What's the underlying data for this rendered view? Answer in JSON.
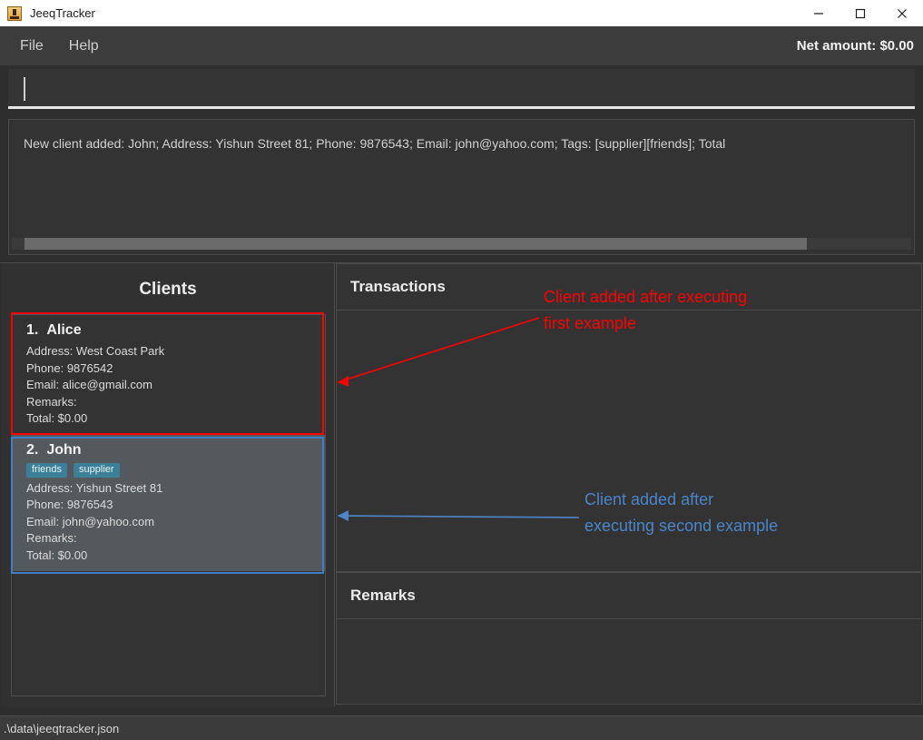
{
  "window": {
    "title": "JeeqTracker",
    "icon": "app-icon",
    "controls": [
      {
        "name": "minimize",
        "glyph": "minimize-icon"
      },
      {
        "name": "maximize",
        "glyph": "maximize-icon"
      },
      {
        "name": "close",
        "glyph": "close-icon"
      }
    ]
  },
  "menubar": {
    "items": [
      {
        "label": "File"
      },
      {
        "label": "Help"
      }
    ],
    "net_amount_label": "Net amount: $0.00"
  },
  "command_input": {
    "value": "",
    "placeholder": ""
  },
  "result_display": {
    "text": "New client added: John; Address: Yishun Street 81; Phone: 9876543; Email: john@yahoo.com; Tags: [supplier][friends]; Total"
  },
  "clients_panel": {
    "title": "Clients",
    "cards": [
      {
        "index": "1.",
        "name": "Alice",
        "tags": [],
        "address": "Address: West Coast Park",
        "phone": "Phone: 9876542",
        "email": "Email: alice@gmail.com",
        "remarks": "Remarks:",
        "total": "Total: $0.00",
        "selected": false
      },
      {
        "index": "2.",
        "name": "John",
        "tags": [
          "friends",
          "supplier"
        ],
        "address": "Address: Yishun Street 81",
        "phone": "Phone: 9876543",
        "email": "Email: john@yahoo.com",
        "remarks": "Remarks:",
        "total": "Total: $0.00",
        "selected": true
      }
    ]
  },
  "transactions_panel": {
    "title": "Transactions",
    "items": []
  },
  "remarks_panel": {
    "title": "Remarks",
    "items": []
  },
  "statusbar": {
    "file_path": ".\\data\\jeeqtracker.json"
  },
  "annotations": [
    {
      "id": "first-example",
      "text": "Client added after executing\nfirst example",
      "color": "#ff0000"
    },
    {
      "id": "second-example",
      "text": "Client added after\nexecuting second example",
      "color": "#4a86c8"
    }
  ],
  "colors": {
    "window_bg": "#2e2e2e",
    "panel_bg": "#333333",
    "menubar_bg": "#3c3c3c",
    "titlebar_bg": "#ffffff",
    "selected_card_bg": "#54595d",
    "tag_bg": "#3b7f99",
    "annotation_red": "#ff0000",
    "annotation_blue": "#3d7ec4"
  }
}
